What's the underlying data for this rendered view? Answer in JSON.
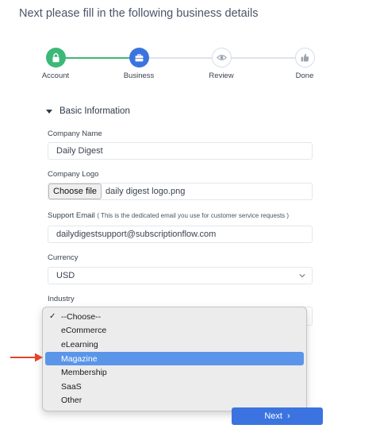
{
  "heading": "Next please fill in the following business details",
  "stepper": {
    "steps": [
      {
        "label": "Account",
        "state": "complete",
        "icon": "lock-icon"
      },
      {
        "label": "Business",
        "state": "active",
        "icon": "briefcase-icon"
      },
      {
        "label": "Review",
        "state": "pending",
        "icon": "eye-icon"
      },
      {
        "label": "Done",
        "state": "pending",
        "icon": "thumbs-up-icon"
      }
    ]
  },
  "section": {
    "title": "Basic Information"
  },
  "fields": {
    "company_name": {
      "label": "Company Name",
      "value": "Daily Digest"
    },
    "company_logo": {
      "label": "Company Logo",
      "button": "Choose file",
      "file_name": "daily digest logo.png"
    },
    "support_email": {
      "label": "Support Email",
      "hint": "( This is the dedicated email you use for customer service requests )",
      "value": "dailydigestsupport@subscriptionflow.com"
    },
    "currency": {
      "label": "Currency",
      "value": "USD"
    },
    "industry": {
      "label": "Industry",
      "options": [
        "--Choose--",
        "eCommerce",
        "eLearning",
        "Magazine",
        "Membership",
        "SaaS",
        "Other"
      ],
      "checked": "--Choose--",
      "highlighted": "Magazine"
    }
  },
  "next_button": {
    "label": "Next",
    "icon": "chevron-right-icon"
  },
  "colors": {
    "primary": "#3b74e0",
    "success": "#3cb878",
    "highlight": "#5b95ea",
    "arrow": "#e2452b"
  }
}
